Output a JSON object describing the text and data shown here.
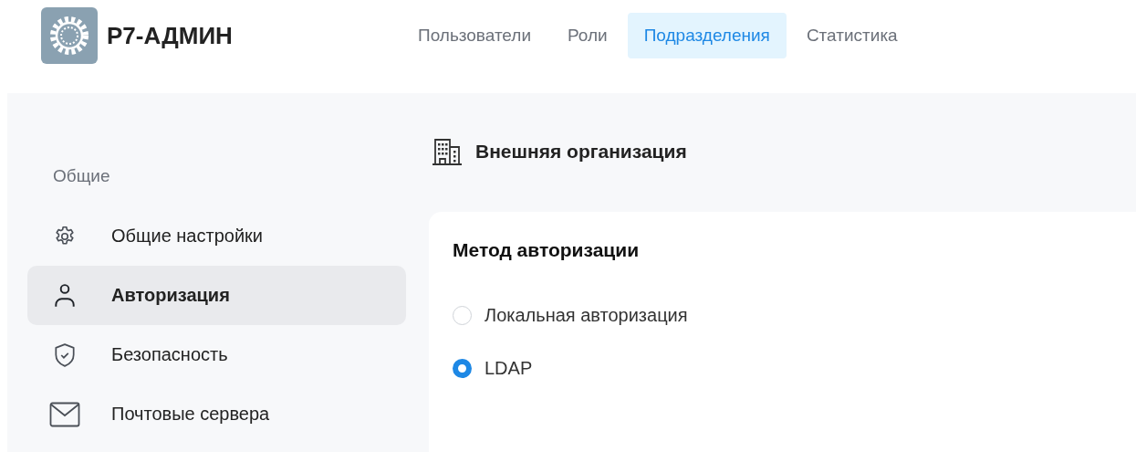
{
  "app": {
    "title": "Р7-АДМИН"
  },
  "nav_tabs": [
    {
      "label": "Пользователи",
      "selected": false
    },
    {
      "label": "Роли",
      "selected": false
    },
    {
      "label": "Подразделения",
      "selected": true
    },
    {
      "label": "Статистика",
      "selected": false
    }
  ],
  "sidebar": {
    "section": "Общие",
    "items": [
      {
        "label": "Общие настройки",
        "selected": false
      },
      {
        "label": "Авторизация",
        "selected": true
      },
      {
        "label": "Безопасность",
        "selected": false
      },
      {
        "label": "Почтовые сервера",
        "selected": false
      }
    ]
  },
  "page": {
    "title": "Внешняя организация"
  },
  "card": {
    "title": "Метод авторизации",
    "options": [
      {
        "label": "Локальная авторизация",
        "selected": false
      },
      {
        "label": "LDAP",
        "selected": true
      }
    ]
  }
}
